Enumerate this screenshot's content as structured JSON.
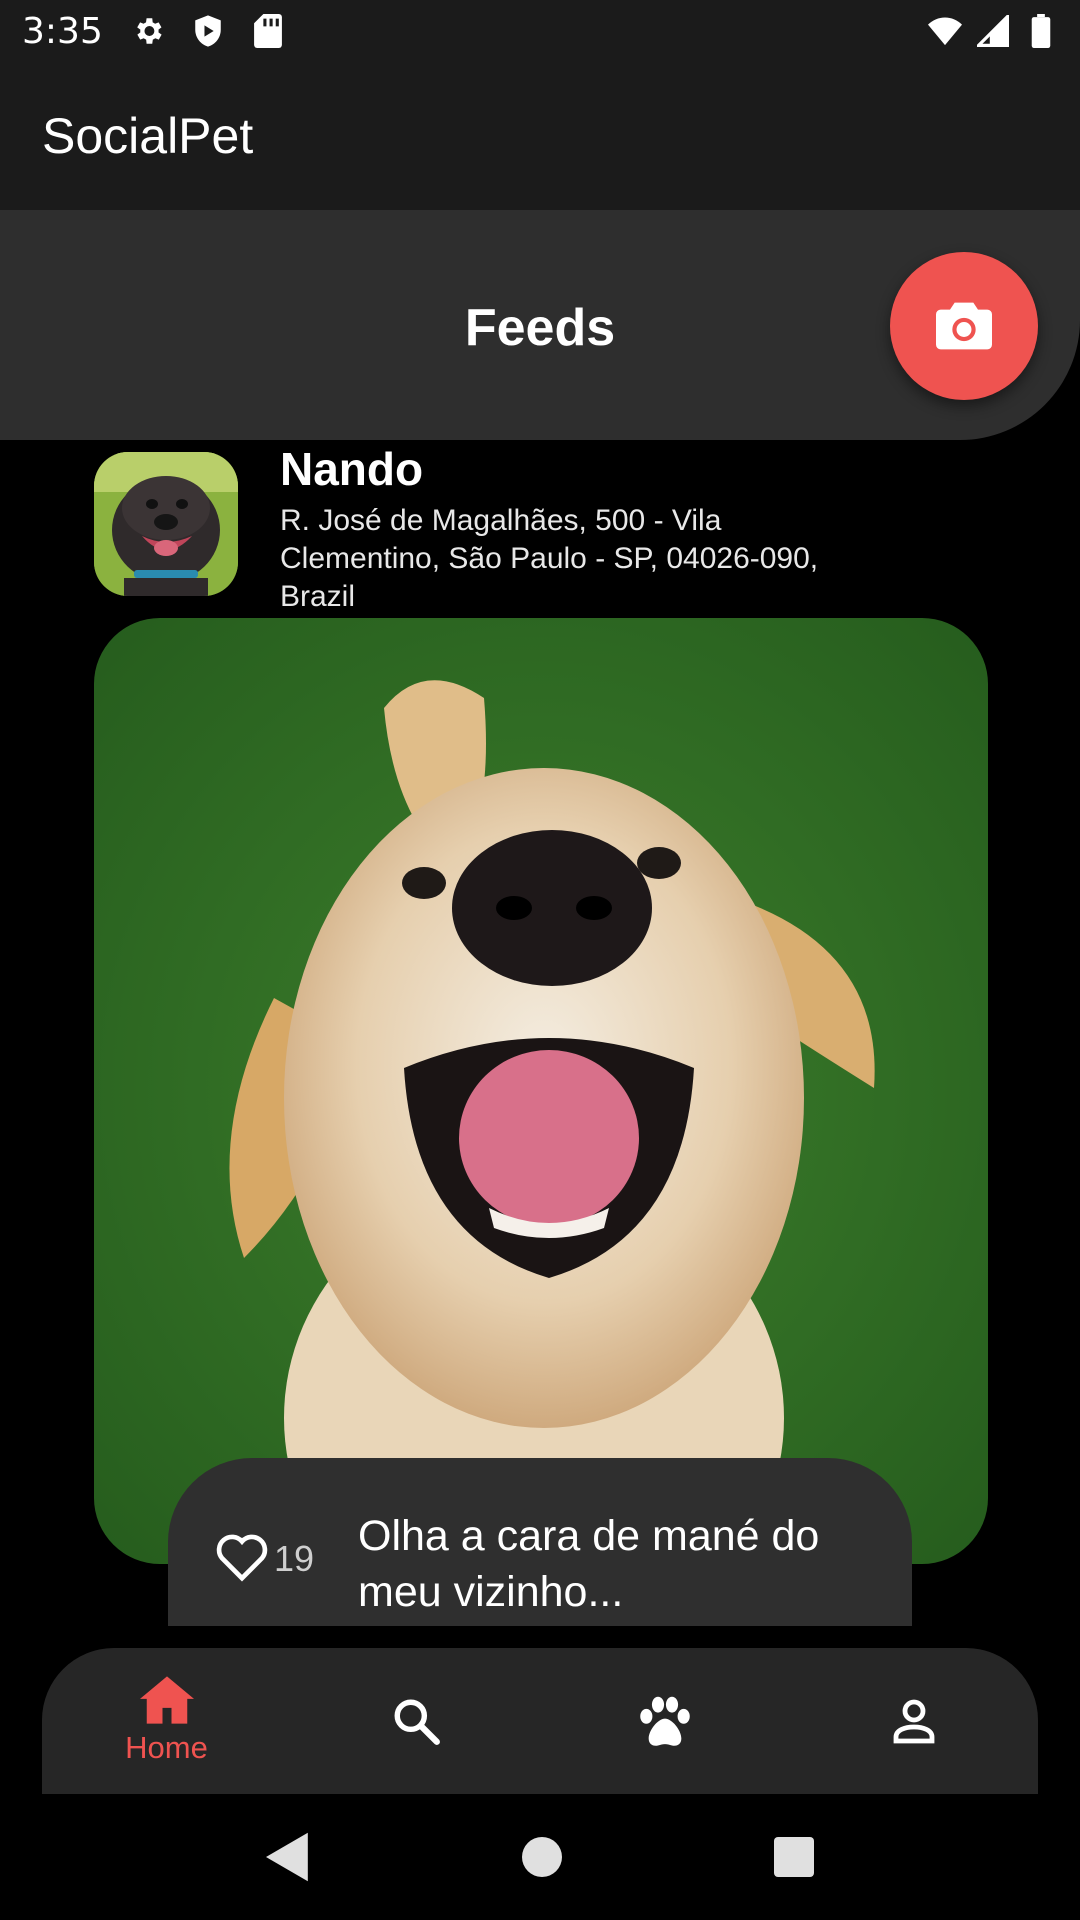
{
  "status_bar": {
    "time": "3:35",
    "left_icons": [
      "settings-icon",
      "play-protect-icon",
      "sd-card-icon"
    ],
    "right_icons": [
      "wifi-icon",
      "cell-signal-icon",
      "battery-icon"
    ]
  },
  "app_bar": {
    "title": "SocialPet"
  },
  "feeds": {
    "title": "Feeds",
    "camera_button_icon": "camera-icon",
    "accent_color": "#ef5350"
  },
  "post": {
    "author": "Nando",
    "address": "R. José de Magalhães, 500 - Vila Clementino, São Paulo - SP, 04026-090, Brazil",
    "likes": "19",
    "caption": "Olha a cara de mané do meu vizinho..."
  },
  "bottom_nav": {
    "items": [
      {
        "label": "Home",
        "icon": "home-icon",
        "active": true
      },
      {
        "label": "",
        "icon": "search-icon",
        "active": false
      },
      {
        "label": "",
        "icon": "paw-icon",
        "active": false
      },
      {
        "label": "",
        "icon": "profile-icon",
        "active": false
      }
    ]
  },
  "system_nav": {
    "icons": [
      "back-icon",
      "home-circle-icon",
      "recents-icon"
    ]
  }
}
